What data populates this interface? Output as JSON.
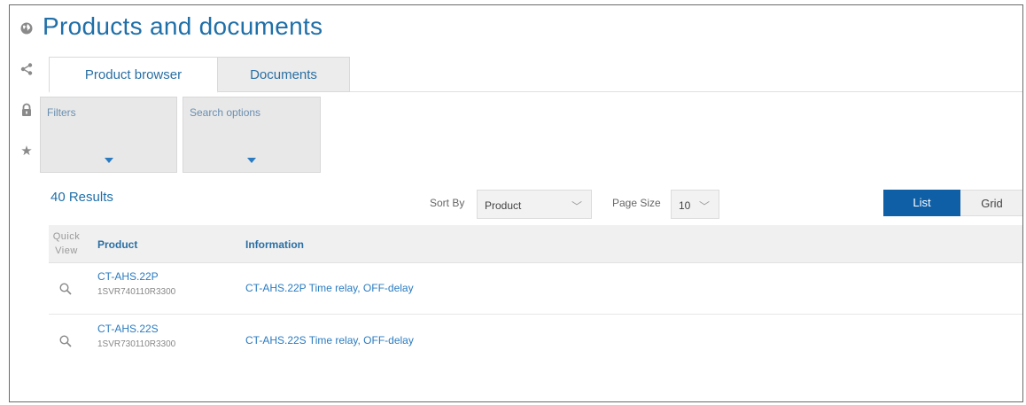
{
  "page": {
    "title": "Products and documents"
  },
  "rail": {
    "icons": [
      "globe-icon",
      "share-icon",
      "lock-icon",
      "star-icon"
    ]
  },
  "tabs": [
    {
      "label": "Product browser",
      "active": true
    },
    {
      "label": "Documents",
      "active": false
    }
  ],
  "filters": {
    "filters_label": "Filters",
    "search_options_label": "Search options"
  },
  "results": {
    "count_text": "40 Results"
  },
  "sort": {
    "label": "Sort By",
    "value": "Product"
  },
  "pagesize": {
    "label": "Page Size",
    "value": "10"
  },
  "view": {
    "list_label": "List",
    "grid_label": "Grid",
    "selected": "List"
  },
  "table": {
    "quick_view_line1": "Quick",
    "quick_view_line2": "View",
    "col_product": "Product",
    "col_information": "Information",
    "rows": [
      {
        "name": "CT-AHS.22P",
        "code": "1SVR740110R3300",
        "info": "CT-AHS.22P Time relay, OFF-delay"
      },
      {
        "name": "CT-AHS.22S",
        "code": "1SVR730110R3300",
        "info": "CT-AHS.22S Time relay, OFF-delay"
      }
    ]
  },
  "colors": {
    "accent": "#1f6fa8",
    "link": "#2a7bc0",
    "list_button": "#0f5fa6"
  }
}
